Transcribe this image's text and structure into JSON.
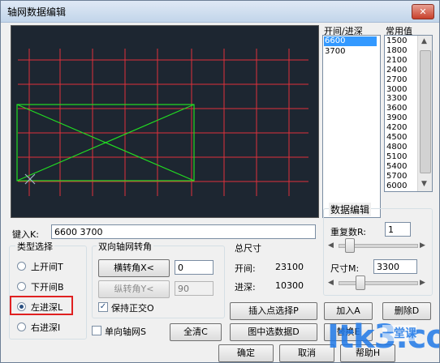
{
  "window": {
    "title": "轴网数据编辑",
    "close_glyph": "✕"
  },
  "spacing_list": {
    "header": "开间/进深",
    "items": [
      "6600",
      "3700"
    ],
    "selected_index": 0
  },
  "common_values": {
    "header": "常用值",
    "items": [
      "1500",
      "1800",
      "2100",
      "2400",
      "2700",
      "3000",
      "3300",
      "3600",
      "3900",
      "4200",
      "4500",
      "4800",
      "5100",
      "5400",
      "5700",
      "6000"
    ]
  },
  "key_input": {
    "label": "键入K:",
    "value": "6600 3700"
  },
  "data_edit": {
    "title": "数据编辑",
    "repeat_label": "重复数R:",
    "repeat_value": "1",
    "size_label": "尺寸M:",
    "size_value": "3300"
  },
  "type_select": {
    "title": "类型选择",
    "options": [
      "上开间T",
      "下开间B",
      "左进深L",
      "右进深I"
    ],
    "selected_index": 2
  },
  "rotate": {
    "title": "双向轴网转角",
    "h_button": "横转角X<",
    "h_value": "0",
    "v_button": "纵转角Y<",
    "v_value": "90",
    "ortho_label": "保持正交O",
    "ortho_checked": true
  },
  "total_size": {
    "title": "总尺寸",
    "bay_label": "开间:",
    "bay_value": "23100",
    "depth_label": "进深:",
    "depth_value": "10300"
  },
  "buttons": {
    "insert_point": "插入点选择P",
    "add": "加入A",
    "delete": "删除D",
    "select_from_drawing": "图中选数据D",
    "replace": "替换E",
    "clear_all": "全清C",
    "ok": "确定",
    "cancel": "取消",
    "help": "帮助H"
  },
  "single_axis": {
    "label": "单向轴网S",
    "checked": false
  },
  "watermark": {
    "text_main": "Itk3.com",
    "text_side": "一堂课"
  },
  "colors": {
    "canvas_bg": "#1d2631",
    "grid_red": "#e0303a",
    "frame_green": "#22dd22",
    "highlight": "#e02020"
  }
}
